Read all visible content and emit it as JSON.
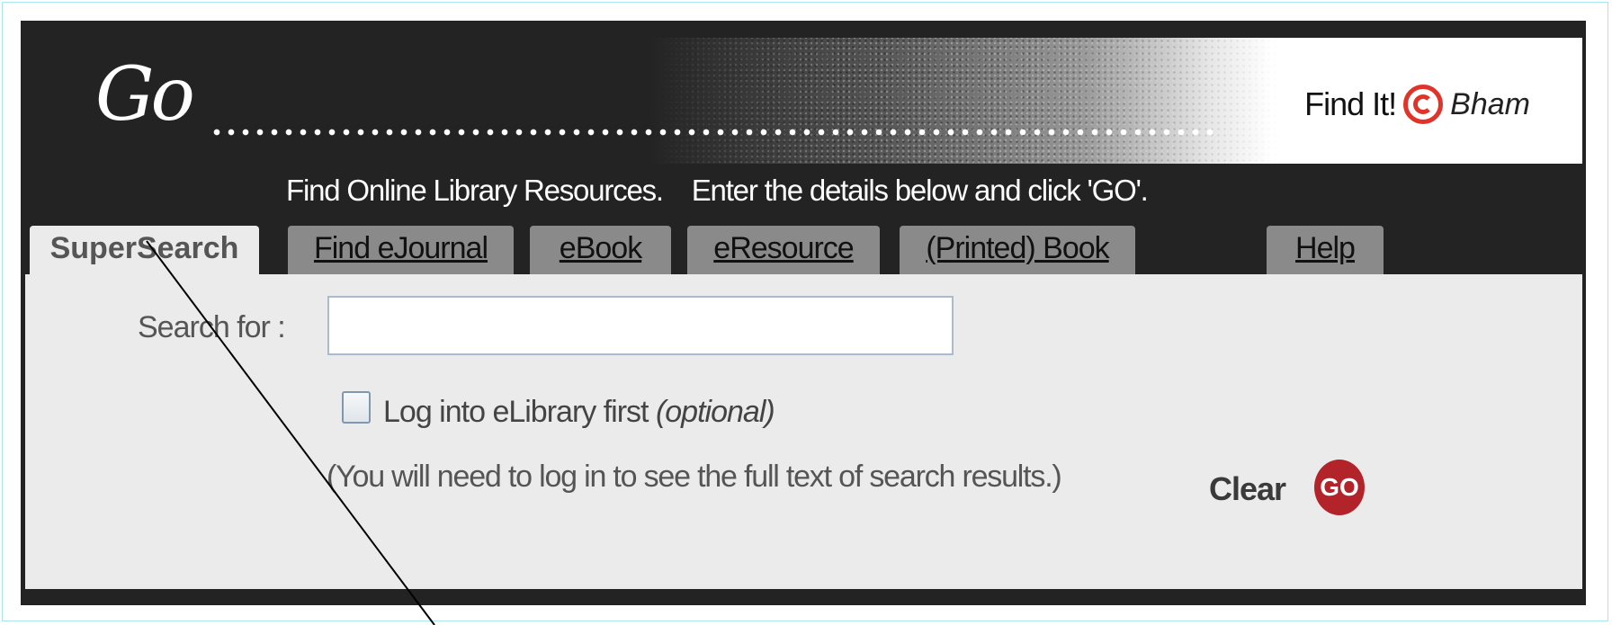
{
  "header": {
    "go_title": "Go",
    "findit_label": "Find It!",
    "brand": "Bham",
    "instructions": "Find Online Library Resources.    Enter the details below and click 'GO'."
  },
  "tabs": [
    {
      "label": "SuperSearch",
      "active": true
    },
    {
      "label": "Find eJournal"
    },
    {
      "label": "eBook"
    },
    {
      "label": "eResource"
    },
    {
      "label": "(Printed) Book"
    },
    {
      "label": "Help"
    }
  ],
  "form": {
    "search_label": "Search for :",
    "search_value": "",
    "login_label": "Log into eLibrary first",
    "login_optional": "(optional)",
    "login_checked": false,
    "note": "(You will need to log in to see the full text of search results.)",
    "clear_label": "Clear",
    "go_label": "GO"
  },
  "colors": {
    "background": "#232323",
    "panel": "#ebebeb",
    "tab_inactive": "#8a8a8a",
    "go_button": "#b3242a",
    "logo_red": "#e0332a"
  },
  "icons": [
    "findit-logo-icon",
    "checkbox-icon",
    "go-circle-icon"
  ]
}
